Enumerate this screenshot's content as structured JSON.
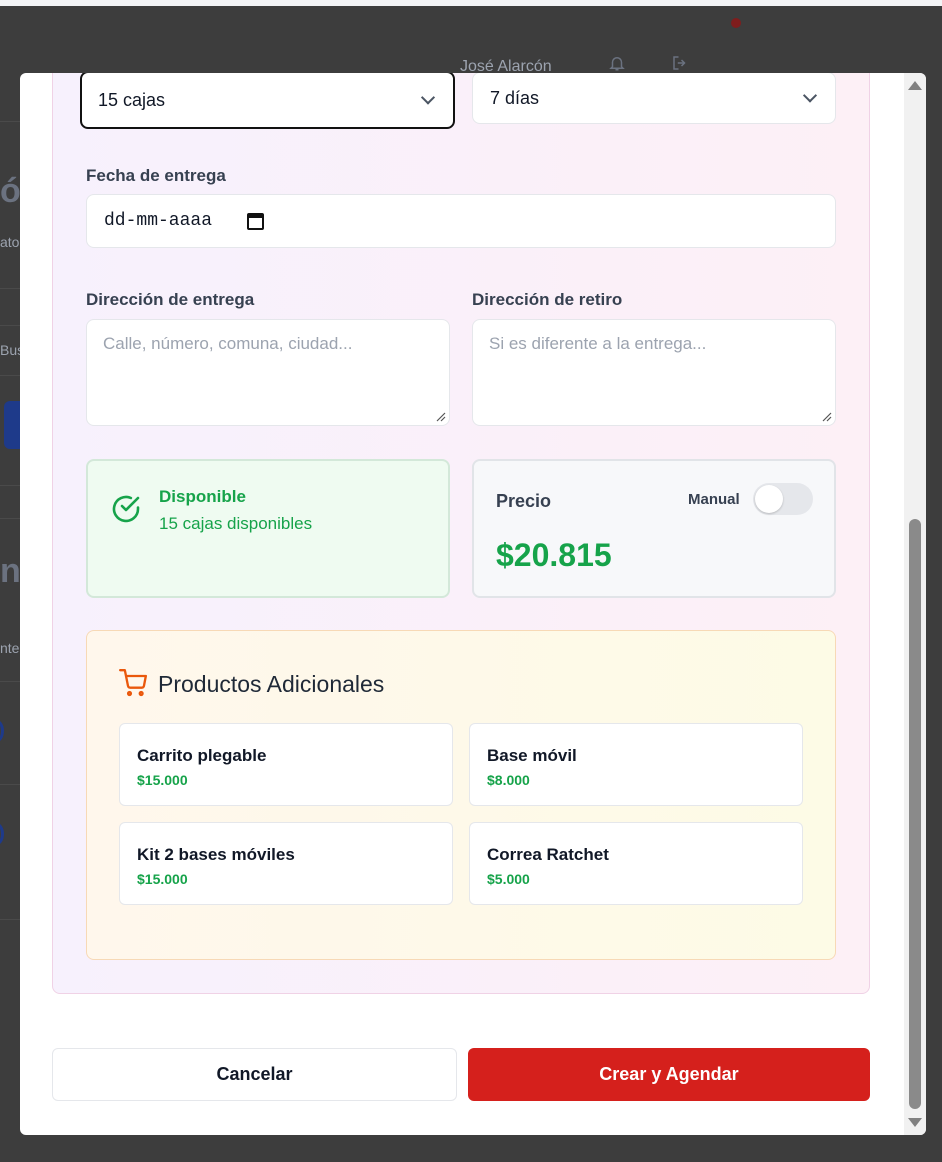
{
  "background": {
    "user_name": "José Alarcón",
    "fragments": [
      "ó",
      "ato",
      "Bus",
      "nt",
      "nte"
    ]
  },
  "form": {
    "quantity_value": "15 cajas",
    "duration_value": "7 días",
    "delivery_date_label": "Fecha de entrega",
    "delivery_date_placeholder": "dd-mm-aaaa",
    "delivery_address_label": "Dirección de entrega",
    "delivery_address_placeholder": "Calle, número, comuna, ciudad...",
    "pickup_address_label": "Dirección de retiro",
    "pickup_address_placeholder": "Si es diferente a la entrega..."
  },
  "availability": {
    "status": "Disponible",
    "detail": "15 cajas disponibles"
  },
  "price": {
    "label": "Precio",
    "manual_label": "Manual",
    "manual_enabled": false,
    "value": "$20.815"
  },
  "addons": {
    "title": "Productos Adicionales",
    "items": [
      {
        "name": "Carrito plegable",
        "price": "$15.000"
      },
      {
        "name": "Base móvil",
        "price": "$8.000"
      },
      {
        "name": "Kit 2 bases móviles",
        "price": "$15.000"
      },
      {
        "name": "Correa Ratchet",
        "price": "$5.000"
      }
    ]
  },
  "actions": {
    "cancel_label": "Cancelar",
    "submit_label": "Crear y Agendar"
  },
  "colors": {
    "accent_red": "#d5201c",
    "success_green": "#16a34a"
  },
  "icons": [
    "chevron-down-icon",
    "calendar-icon",
    "check-circle-icon",
    "shopping-cart-icon",
    "bell-icon",
    "logout-icon"
  ]
}
